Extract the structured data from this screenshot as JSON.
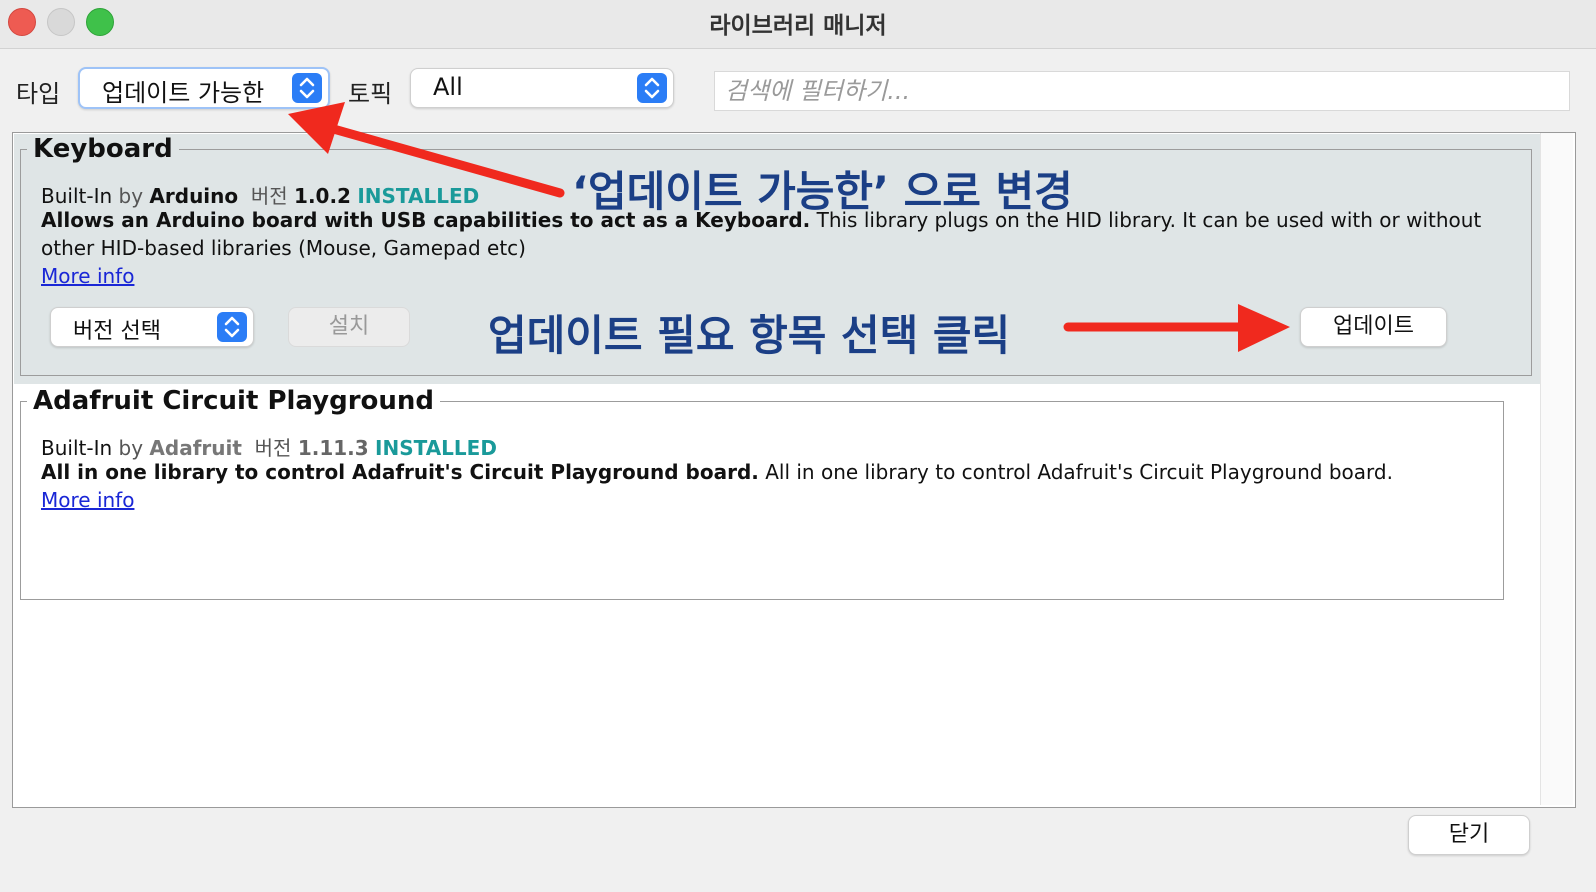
{
  "window": {
    "title": "라이브러리 매니저"
  },
  "filters": {
    "type_label": "타입",
    "type_value": "업데이트 가능한",
    "topic_label": "토픽",
    "topic_value": "All",
    "search_placeholder": "검색에 필터하기..."
  },
  "libraries": [
    {
      "name": "Keyboard",
      "builtin": "Built-In",
      "by": "by",
      "author": "Arduino",
      "version_label": "버전",
      "version": "1.0.2",
      "status": "INSTALLED",
      "summary_bold": "Allows an Arduino board with USB capabilities to act as a Keyboard.",
      "summary_rest": "This library plugs on the HID library. It can be used with or without",
      "summary_line2": "other HID-based libraries (Mouse, Gamepad etc)",
      "more_info": "More info",
      "version_select": "버전 선택",
      "install_button": "설치",
      "update_button": "업데이트"
    },
    {
      "name": "Adafruit Circuit Playground",
      "builtin": "Built-In",
      "by": "by",
      "author": "Adafruit",
      "version_label": "버전",
      "version": "1.11.3",
      "status": "INSTALLED",
      "summary_bold": "All in one library to control Adafruit's Circuit Playground board.",
      "summary_rest": "All in one library to control Adafruit's Circuit Playground board.",
      "more_info": "More info"
    }
  ],
  "footer": {
    "close_button": "닫기"
  },
  "annotations": {
    "change_type": "‘업데이트 가능한’ 으로 변경",
    "click_update": "업데이트 필요 항목 선택 클릭"
  },
  "colors": {
    "arrow": "#f0291e",
    "annotation_text": "#1b3f86",
    "installed": "#1a9a9a",
    "link": "#1a27d6",
    "selected_row": "#dfe5e6"
  }
}
